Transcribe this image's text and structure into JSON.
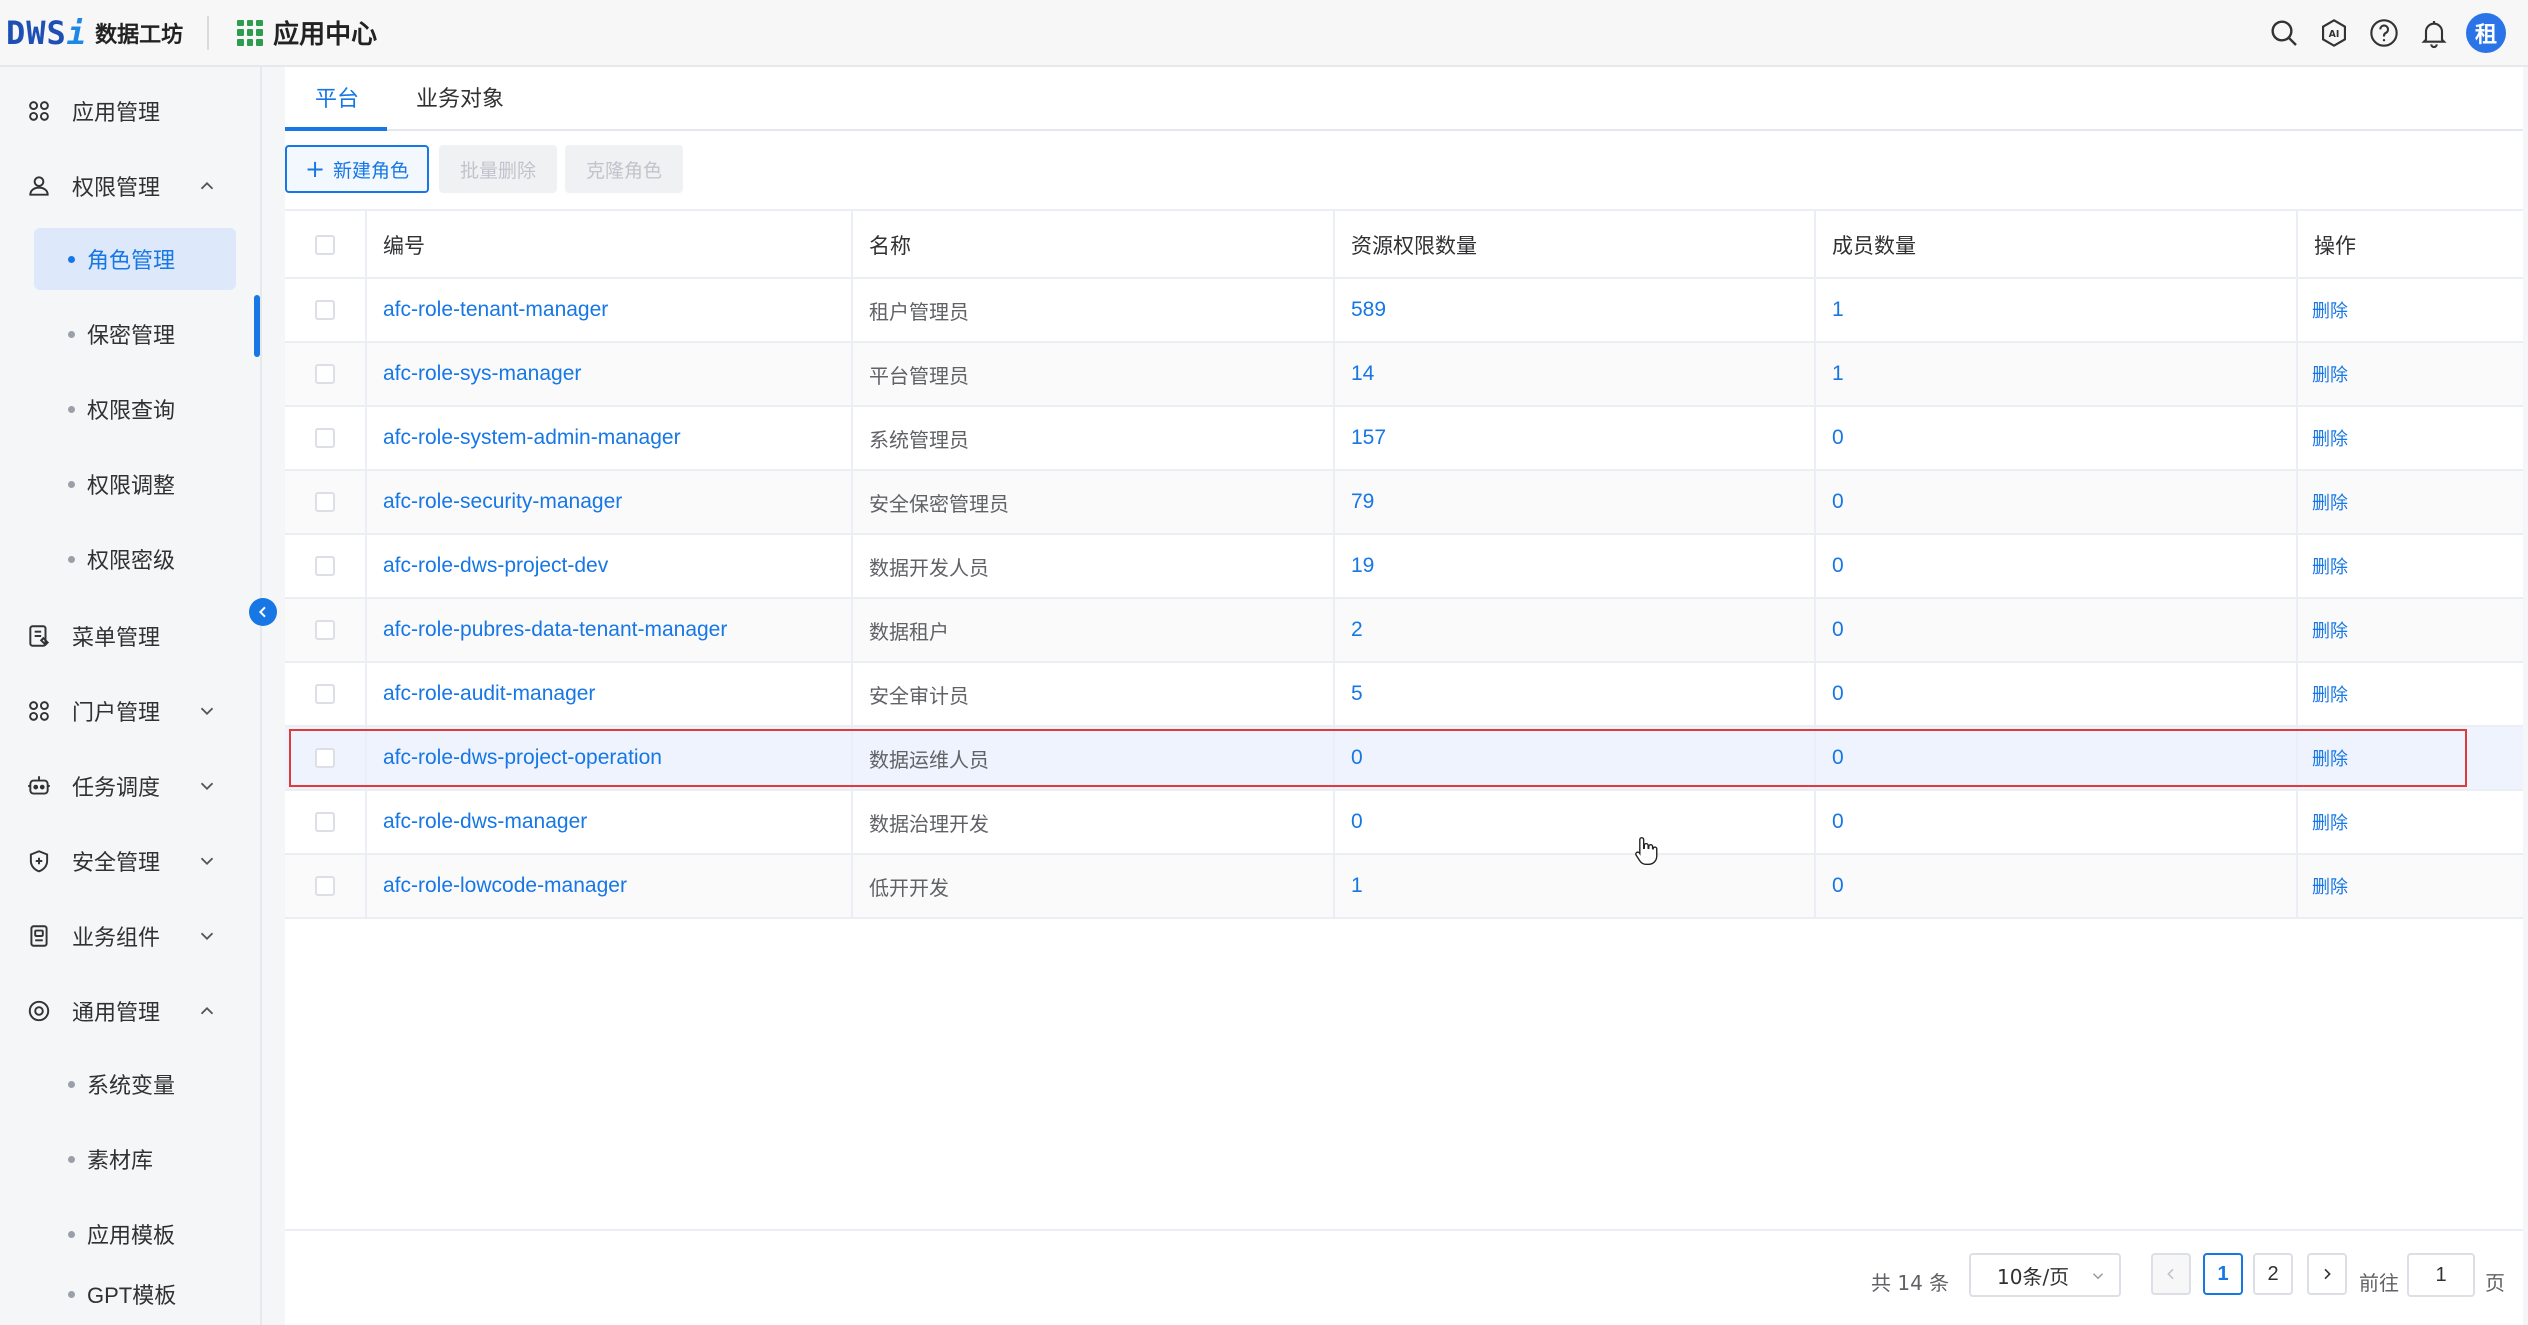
{
  "header": {
    "logo_text": "DWS",
    "logo_i": "i",
    "product_name": "数据工坊",
    "app_center_label": "应用中心",
    "avatar_text": "租",
    "icons": [
      "search-icon",
      "ai-icon",
      "help-icon",
      "bell-icon"
    ]
  },
  "sidebar": {
    "items": [
      {
        "label": "应用管理",
        "icon": "apps-icon"
      },
      {
        "label": "权限管理",
        "icon": "user-lock-icon",
        "expanded": true
      },
      {
        "label": "菜单管理",
        "icon": "menu-doc-icon"
      },
      {
        "label": "门户管理",
        "icon": "portal-icon",
        "expanded": false
      },
      {
        "label": "任务调度",
        "icon": "robot-icon",
        "expanded": false
      },
      {
        "label": "安全管理",
        "icon": "shield-icon",
        "expanded": false
      },
      {
        "label": "业务组件",
        "icon": "component-icon",
        "expanded": false
      },
      {
        "label": "通用管理",
        "icon": "settings-ring-icon",
        "expanded": true
      }
    ],
    "permission_sub": [
      "角色管理",
      "保密管理",
      "权限查询",
      "权限调整",
      "权限密级"
    ],
    "general_sub": [
      "系统变量",
      "素材库",
      "应用模板",
      "GPT模板"
    ],
    "active_sub": "角色管理"
  },
  "tabs": [
    "平台",
    "业务对象"
  ],
  "toolbar": {
    "new_role": "新建角色",
    "batch_delete": "批量删除",
    "clone_role": "克隆角色"
  },
  "table": {
    "columns": [
      "编号",
      "名称",
      "资源权限数量",
      "成员数量",
      "操作"
    ],
    "rows": [
      {
        "code": "afc-role-tenant-manager",
        "name": "租户管理员",
        "resources": "589",
        "members": "1",
        "op": "删除"
      },
      {
        "code": "afc-role-sys-manager",
        "name": "平台管理员",
        "resources": "14",
        "members": "1",
        "op": "删除"
      },
      {
        "code": "afc-role-system-admin-manager",
        "name": "系统管理员",
        "resources": "157",
        "members": "0",
        "op": "删除"
      },
      {
        "code": "afc-role-security-manager",
        "name": "安全保密管理员",
        "resources": "79",
        "members": "0",
        "op": "删除"
      },
      {
        "code": "afc-role-dws-project-dev",
        "name": "数据开发人员",
        "resources": "19",
        "members": "0",
        "op": "删除"
      },
      {
        "code": "afc-role-pubres-data-tenant-manager",
        "name": "数据租户",
        "resources": "2",
        "members": "0",
        "op": "删除"
      },
      {
        "code": "afc-role-audit-manager",
        "name": "安全审计员",
        "resources": "5",
        "members": "0",
        "op": "删除"
      },
      {
        "code": "afc-role-dws-project-operation",
        "name": "数据运维人员",
        "resources": "0",
        "members": "0",
        "op": "删除"
      },
      {
        "code": "afc-role-dws-manager",
        "name": "数据治理开发",
        "resources": "0",
        "members": "0",
        "op": "删除"
      },
      {
        "code": "afc-role-lowcode-manager",
        "name": "低开开发",
        "resources": "1",
        "members": "0",
        "op": "删除"
      }
    ],
    "selected_row": 7
  },
  "pagination": {
    "total": "共 14 条",
    "page_size": "10条/页",
    "pages": [
      "1",
      "2"
    ],
    "current_page": "1",
    "goto_prefix": "前往",
    "goto_value": "1",
    "goto_suffix": "页"
  },
  "colors": {
    "accent": "#1677e5",
    "selection_outline": "#e03b3b",
    "brand_green": "#2e9d4f"
  }
}
